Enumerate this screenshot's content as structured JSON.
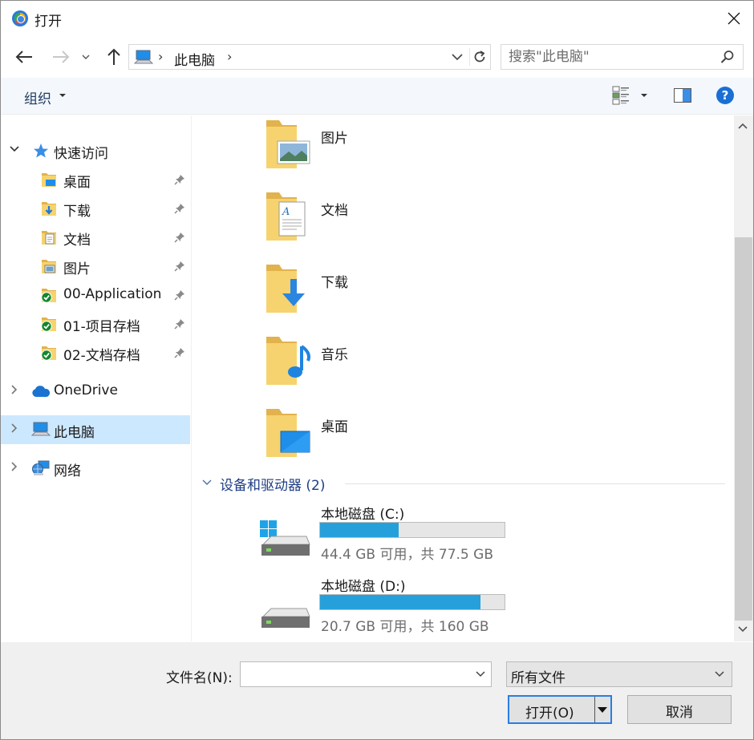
{
  "window": {
    "title": "打开"
  },
  "address": {
    "location": "此电脑"
  },
  "search": {
    "placeholder": "搜索\"此电脑\""
  },
  "toolbar": {
    "organize_label": "组织"
  },
  "sidebar": {
    "quick_access": "快速访问",
    "quick_items": [
      {
        "label": "桌面",
        "icon": "desktop-folder-icon"
      },
      {
        "label": "下载",
        "icon": "downloads-folder-icon"
      },
      {
        "label": "文档",
        "icon": "documents-folder-icon"
      },
      {
        "label": "图片",
        "icon": "pictures-folder-icon"
      },
      {
        "label": "00-Application",
        "icon": "synced-folder-icon"
      },
      {
        "label": "01-项目存档",
        "icon": "synced-folder-icon"
      },
      {
        "label": "02-文档存档",
        "icon": "synced-folder-icon"
      }
    ],
    "onedrive": "OneDrive",
    "this_pc": "此电脑",
    "network": "网络"
  },
  "main": {
    "folders": [
      {
        "name": "图片",
        "icon": "pictures-folder-icon"
      },
      {
        "name": "文档",
        "icon": "documents-folder-icon"
      },
      {
        "name": "下载",
        "icon": "downloads-folder-icon"
      },
      {
        "name": "音乐",
        "icon": "music-folder-icon"
      },
      {
        "name": "桌面",
        "icon": "desktop-folder-icon"
      }
    ],
    "devices_header": "设备和驱动器 (2)",
    "drives": [
      {
        "name": "本地磁盘 (C:)",
        "free_text": "44.4 GB 可用，共 77.5 GB",
        "used_fraction": 0.427
      },
      {
        "name": "本地磁盘 (D:)",
        "free_text": "20.7 GB 可用，共 160 GB",
        "used_fraction": 0.871
      }
    ]
  },
  "bottom": {
    "filename_label": "文件名(N):",
    "filename_value": "",
    "filter_value": "所有文件",
    "open_label": "打开(O)",
    "cancel_label": "取消"
  },
  "colors": {
    "accent": "#26a0da",
    "selection": "#cce8ff",
    "help": "#1a6fd3"
  }
}
